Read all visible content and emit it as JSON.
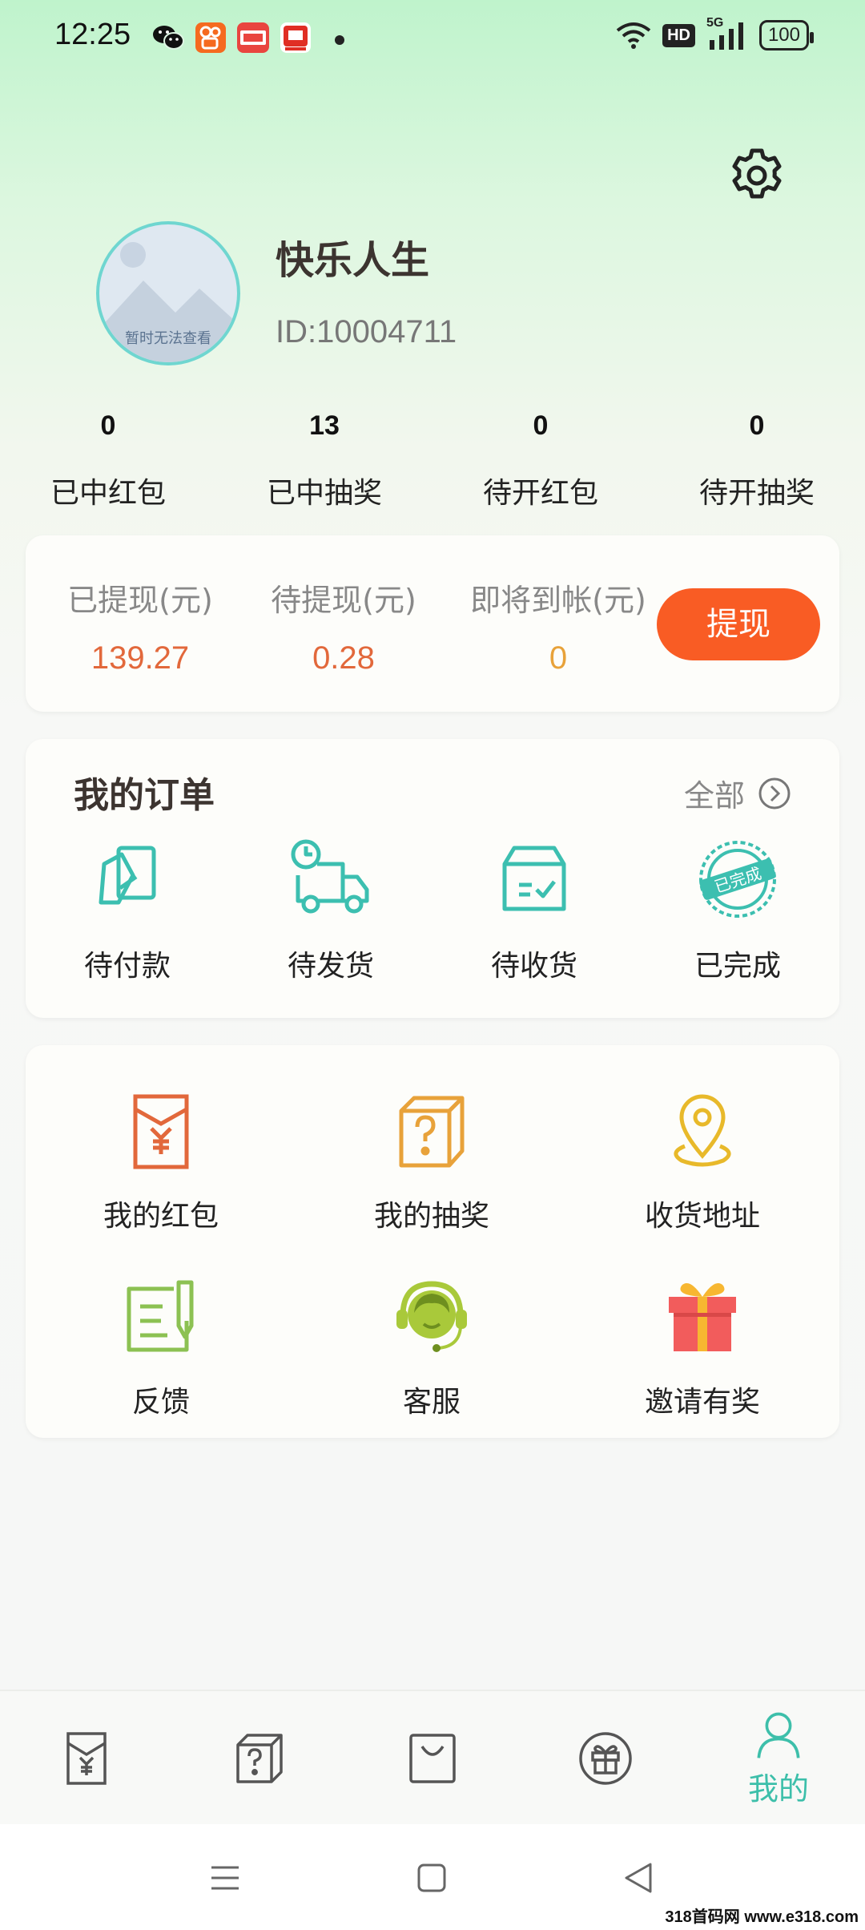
{
  "status_bar": {
    "time": "12:25",
    "apps": [
      "wechat-icon",
      "kuaishou-icon",
      "toutiao-icon",
      "pinduoduo-icon"
    ],
    "hd_badge": "HD",
    "network": "5G",
    "battery": "100"
  },
  "profile": {
    "avatar_placeholder": "暂时无法查看",
    "username": "快乐人生",
    "user_id": "ID:10004711"
  },
  "stats": [
    {
      "value": "0",
      "label": "已中红包"
    },
    {
      "value": "13",
      "label": "已中抽奖"
    },
    {
      "value": "0",
      "label": "待开红包"
    },
    {
      "value": "0",
      "label": "待开抽奖"
    }
  ],
  "wallet": {
    "items": [
      {
        "label": "已提现(元)",
        "value": "139.27",
        "color": "#e2683b"
      },
      {
        "label": "待提现(元)",
        "value": "0.28",
        "color": "#e2683b"
      },
      {
        "label": "即将到帐(元)",
        "value": "0",
        "color": "#e8a23a"
      }
    ],
    "withdraw_button": "提现"
  },
  "orders": {
    "title": "我的订单",
    "all_label": "全部",
    "items": [
      {
        "label": "待付款",
        "icon": "payment-card-icon"
      },
      {
        "label": "待发货",
        "icon": "delivery-truck-icon"
      },
      {
        "label": "待收货",
        "icon": "package-box-icon"
      },
      {
        "label": "已完成",
        "icon": "completed-stamp-icon"
      }
    ],
    "stamp_text": "已完成",
    "accent": "#3cbfb0"
  },
  "services": [
    {
      "label": "我的红包",
      "icon": "red-envelope-icon",
      "color": "#e2683b"
    },
    {
      "label": "我的抽奖",
      "icon": "mystery-box-icon",
      "color": "#e8a23a"
    },
    {
      "label": "收货地址",
      "icon": "location-pin-icon",
      "color": "#e8b92a"
    },
    {
      "label": "反馈",
      "icon": "feedback-note-icon",
      "color": "#8cc152"
    },
    {
      "label": "客服",
      "icon": "customer-service-icon",
      "color": "#a9c93a"
    },
    {
      "label": "邀请有奖",
      "icon": "gift-icon",
      "color": "#f25c5c"
    }
  ],
  "tab_bar": {
    "tabs": [
      {
        "icon": "red-envelope-tab-icon",
        "label": ""
      },
      {
        "icon": "mystery-box-tab-icon",
        "label": ""
      },
      {
        "icon": "shopping-bag-tab-icon",
        "label": ""
      },
      {
        "icon": "gift-tab-icon",
        "label": ""
      },
      {
        "icon": "profile-tab-icon",
        "label": "我的"
      }
    ],
    "active_color": "#3dbfaa"
  },
  "watermark": "318首码网 www.e318.com"
}
